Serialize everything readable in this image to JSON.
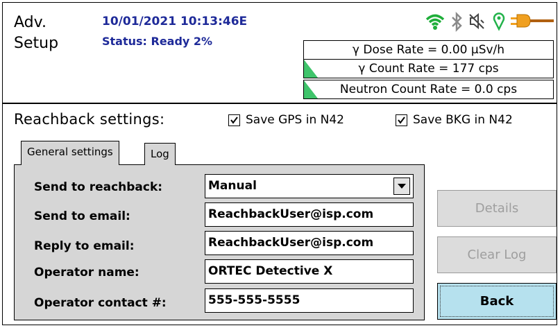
{
  "header": {
    "title_line1": "Adv.",
    "title_line2": "Setup",
    "datetime": "10/01/2021 10:13:46E",
    "status": "Status: Ready 2%"
  },
  "status_icons": [
    "wifi-icon",
    "bluetooth-icon",
    "muted-speaker-icon",
    "gps-pin-icon",
    "power-plug-icon"
  ],
  "rates": {
    "dose_rate": "γ Dose Rate = 0.00  μSv/h",
    "count_rate": "γ Count Rate = 177 cps",
    "neutron_rate": "Neutron Count Rate = 0.0 cps"
  },
  "reachback": {
    "label": "Reachback settings:",
    "save_gps_label": "Save GPS in N42",
    "save_gps_checked": true,
    "save_bkg_label": "Save BKG in N42",
    "save_bkg_checked": true
  },
  "tabs": [
    {
      "label": "General settings",
      "active": true
    },
    {
      "label": "Log",
      "active": false
    }
  ],
  "form": {
    "send_to_reachback_label": "Send to reachback:",
    "send_to_reachback_value": "Manual",
    "send_to_email_label": "Send to email:",
    "send_to_email_value": "ReachbackUser@isp.com",
    "reply_to_email_label": "Reply to email:",
    "reply_to_email_value": "ReachbackUser@isp.com",
    "operator_name_label": "Operator name:",
    "operator_name_value": "ORTEC Detective X",
    "operator_contact_label": "Operator contact #:",
    "operator_contact_value": "555-555-5555"
  },
  "buttons": {
    "details": "Details",
    "clear_log": "Clear Log",
    "back": "Back"
  },
  "colors": {
    "header_text": "#1e2a99",
    "wifi": "#1fae3a",
    "gps": "#22b24a",
    "plug": "#f0a020",
    "rate_indicator": "#3fc46b",
    "back_button": "#b6e1ee",
    "panel_bg": "#d6d6d6"
  }
}
